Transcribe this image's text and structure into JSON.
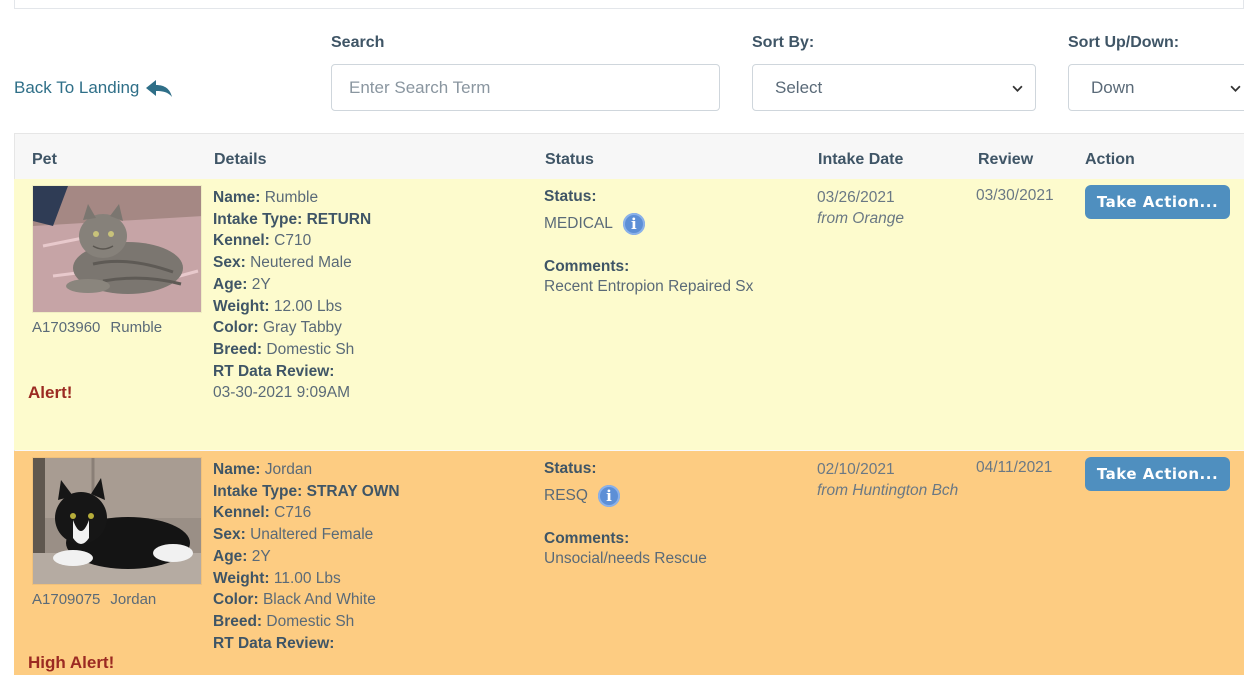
{
  "nav": {
    "back_label": "Back To Landing"
  },
  "search": {
    "label": "Search",
    "placeholder": "Enter Search Term"
  },
  "sort_by": {
    "label": "Sort By:",
    "selected": "Select"
  },
  "sort_direction": {
    "label": "Sort Up/Down:",
    "selected": "Down"
  },
  "table": {
    "headers": [
      "Pet",
      "Details",
      "Status",
      "Intake Date",
      "Review",
      "Action"
    ],
    "detail_keys": {
      "name": "Name:",
      "intake_type": "Intake Type:",
      "kennel": "Kennel:",
      "sex": "Sex:",
      "age": "Age:",
      "weight": "Weight:",
      "color": "Color:",
      "breed": "Breed:",
      "rt_review": "RT Data Review:"
    },
    "status_key": "Status:",
    "comments_key": "Comments:",
    "rows": [
      {
        "id": "A1703960",
        "name": "Rumble",
        "alert": "Alert!",
        "intake_type": "RETURN",
        "kennel": "C710",
        "sex": "Neutered Male",
        "age": "2Y",
        "weight": "12.00 Lbs",
        "color": "Gray Tabby",
        "breed": "Domestic Sh",
        "rt_review": "03-30-2021 9:09AM",
        "status": "MEDICAL",
        "comments": "Recent Entropion Repaired Sx",
        "intake_date": "03/26/2021",
        "intake_from": "from Orange",
        "review_date": "03/30/2021",
        "action_label": "Take Action...",
        "row_color": "#fdfbcd"
      },
      {
        "id": "A1709075",
        "name": "Jordan",
        "alert": "High Alert!",
        "intake_type": "STRAY OWN",
        "kennel": "C716",
        "sex": "Unaltered Female",
        "age": "2Y",
        "weight": "11.00 Lbs",
        "color": "Black And White",
        "breed": "Domestic Sh",
        "status": "RESQ",
        "comments": "Unsocial/needs Rescue",
        "intake_date": "02/10/2021",
        "intake_from": "from Huntington Bch",
        "review_date": "04/11/2021",
        "action_label": "Take Action...",
        "row_color": "#fdcc82"
      }
    ]
  },
  "colors": {
    "link": "#2f6f88",
    "alert_text": "#9b2a22",
    "action_button": "#4f8fbf",
    "info_icon": "#5d8fd6"
  },
  "icons": [
    "reply-arrow-icon",
    "chevron-down-icon",
    "info-icon"
  ]
}
